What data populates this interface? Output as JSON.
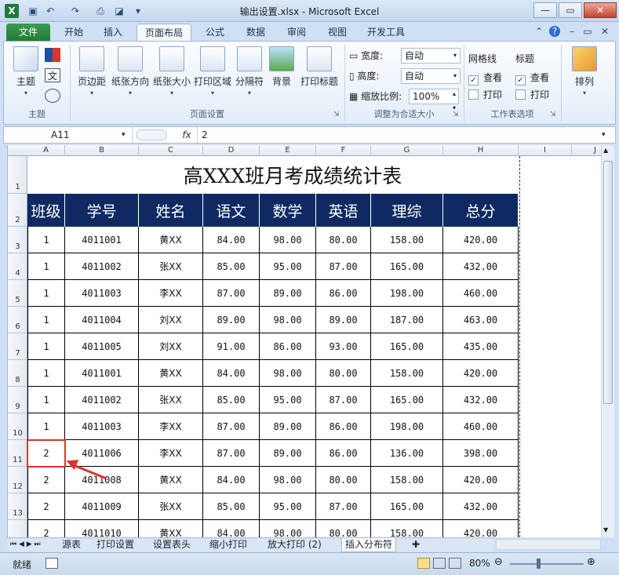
{
  "window": {
    "title": "输出设置.xlsx - Microsoft Excel",
    "minimize": "—",
    "restore": "▭",
    "close": "✕"
  },
  "tabs": [
    "文件",
    "开始",
    "插入",
    "页面布局",
    "公式",
    "数据",
    "审阅",
    "视图",
    "开发工具"
  ],
  "ribbon": {
    "theme_group": {
      "label": "主题",
      "theme_btn": "主题"
    },
    "page_setup": {
      "label": "页面设置",
      "buttons": [
        "页边距",
        "纸张方向",
        "纸张大小",
        "打印区域",
        "分隔符",
        "背景",
        "打印标题"
      ]
    },
    "scale_fit": {
      "label": "调整为合适大小",
      "width_label": "宽度:",
      "width_value": "自动",
      "height_label": "高度:",
      "height_value": "自动",
      "scale_label": "缩放比例:",
      "scale_value": "100%"
    },
    "sheet_options": {
      "label": "工作表选项",
      "gridlines": "网格线",
      "headings": "标题",
      "view": "查看",
      "print": "打印"
    },
    "arrange": {
      "label": "排列"
    }
  },
  "formula_bar": {
    "name_box": "A11",
    "fx": "fx",
    "value": "2"
  },
  "columns": [
    "A",
    "B",
    "C",
    "D",
    "E",
    "F",
    "G",
    "H",
    "I",
    "J"
  ],
  "rows": [
    "1",
    "2",
    "3",
    "4",
    "5",
    "6",
    "7",
    "8",
    "9",
    "10",
    "11",
    "12",
    "13"
  ],
  "table": {
    "title": "高XXX班月考成绩统计表",
    "headers": [
      "班级",
      "学号",
      "姓名",
      "语文",
      "数学",
      "英语",
      "理综",
      "总分"
    ],
    "rows": [
      [
        "1",
        "4011001",
        "黄XX",
        "84.00",
        "98.00",
        "80.00",
        "158.00",
        "420.00"
      ],
      [
        "1",
        "4011002",
        "张XX",
        "85.00",
        "95.00",
        "87.00",
        "165.00",
        "432.00"
      ],
      [
        "1",
        "4011003",
        "李XX",
        "87.00",
        "89.00",
        "86.00",
        "198.00",
        "460.00"
      ],
      [
        "1",
        "4011004",
        "刘XX",
        "89.00",
        "98.00",
        "89.00",
        "187.00",
        "463.00"
      ],
      [
        "1",
        "4011005",
        "刘XX",
        "91.00",
        "86.00",
        "93.00",
        "165.00",
        "435.00"
      ],
      [
        "1",
        "4011001",
        "黄XX",
        "84.00",
        "98.00",
        "80.00",
        "158.00",
        "420.00"
      ],
      [
        "1",
        "4011002",
        "张XX",
        "85.00",
        "95.00",
        "87.00",
        "165.00",
        "432.00"
      ],
      [
        "1",
        "4011003",
        "李XX",
        "87.00",
        "89.00",
        "86.00",
        "198.00",
        "460.00"
      ],
      [
        "2",
        "4011006",
        "李XX",
        "87.00",
        "89.00",
        "86.00",
        "136.00",
        "398.00"
      ],
      [
        "2",
        "4011008",
        "黄XX",
        "84.00",
        "98.00",
        "80.00",
        "158.00",
        "420.00"
      ],
      [
        "2",
        "4011009",
        "张XX",
        "85.00",
        "95.00",
        "87.00",
        "165.00",
        "432.00"
      ],
      [
        "2",
        "4011010",
        "黄XX",
        "84.00",
        "98.00",
        "80.00",
        "158.00",
        "420.00"
      ]
    ]
  },
  "sheet_tabs": [
    "源表",
    "打印设置",
    "设置表头",
    "缩小打印",
    "放大打印 (2)",
    "插入分布符"
  ],
  "status": {
    "ready": "就绪",
    "zoom": "80%"
  },
  "colors": {
    "header_bg": "#0f2a63",
    "selection": "#e1322d",
    "file_tab": "#1f7a36"
  }
}
